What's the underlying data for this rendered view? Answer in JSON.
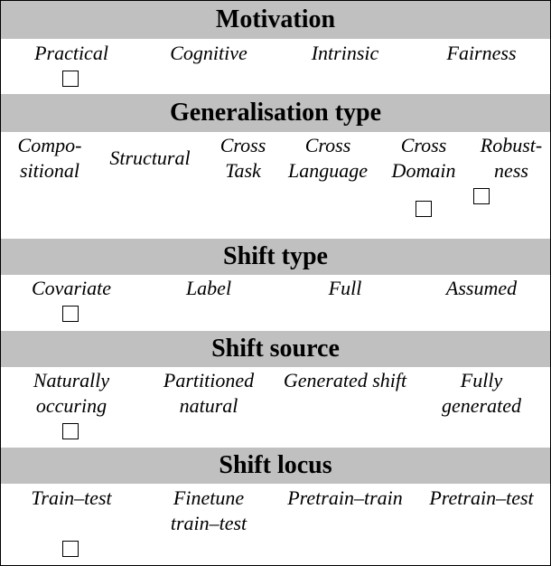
{
  "sections": [
    {
      "title": "Motivation",
      "items": [
        "Practical",
        "Cognitive",
        "Intrinsic",
        "Fairness"
      ]
    },
    {
      "title": "Generalisation type",
      "items": [
        "Compo-\nsitional",
        "Structural",
        "Cross\nTask",
        "Cross\nLanguage",
        "Cross\nDomain",
        "Robust-\nness"
      ]
    },
    {
      "title": "Shift type",
      "items": [
        "Covariate",
        "Label",
        "Full",
        "Assumed"
      ]
    },
    {
      "title": "Shift source",
      "items": [
        "Naturally\noccuring",
        "Partitioned\nnatural",
        "Generated shift",
        "Fully\ngenerated"
      ]
    },
    {
      "title": "Shift locus",
      "items": [
        "Train–test",
        "Finetune\ntrain–test",
        "Pretrain–train",
        "Pretrain–test"
      ]
    }
  ],
  "colors": {
    "header_bg": "#c0c0c0",
    "border": "#000000"
  }
}
